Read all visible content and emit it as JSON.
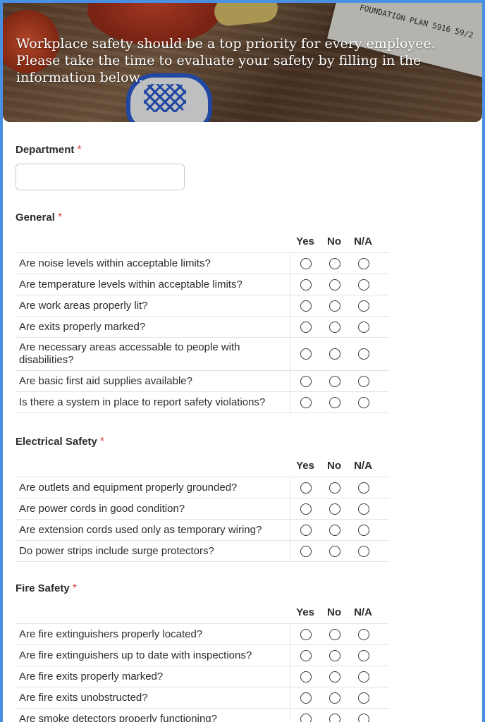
{
  "header": {
    "intro_text": "Workplace safety should be a top priority for every employee. Please take the time to evaluate your safety by filling in the information below.",
    "paper_text": "FOUNDATION PLAN 5916 59/2"
  },
  "department": {
    "label": "Department",
    "required_mark": "*",
    "value": "",
    "placeholder": ""
  },
  "columns": [
    "Yes",
    "No",
    "N/A"
  ],
  "sections": [
    {
      "title": "General",
      "required_mark": "*",
      "questions": [
        "Are noise levels within acceptable limits?",
        "Are temperature levels within acceptable limits?",
        "Are work areas properly lit?",
        "Are exits properly marked?",
        "Are necessary areas accessable to people with disabilities?",
        "Are basic first aid supplies available?",
        "Is there a system in place to report safety violations?"
      ]
    },
    {
      "title": "Electrical Safety",
      "required_mark": "*",
      "questions": [
        "Are outlets and equipment properly grounded?",
        "Are power cords in good condition?",
        "Are extension cords used only as temporary wiring?",
        "Do power strips include surge protectors?"
      ]
    },
    {
      "title": "Fire Safety",
      "required_mark": "*",
      "questions": [
        "Are fire extinguishers properly located?",
        "Are fire extinguishers up to date with inspections?",
        "Are fire exits properly marked?",
        "Are fire exits unobstructed?",
        "Are smoke detectors properly functioning?"
      ]
    }
  ],
  "colors": {
    "page_border": "#4a90e2",
    "required": "#e04545",
    "text": "#2c2c2c"
  }
}
